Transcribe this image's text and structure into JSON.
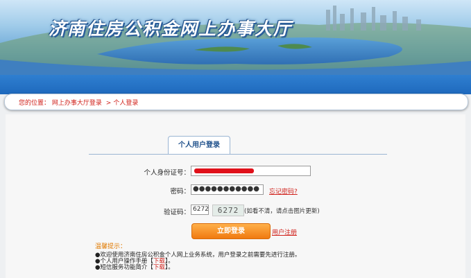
{
  "banner": {
    "title": "济南住房公积金网上办事大厅"
  },
  "breadcrumb": {
    "prefix": "您的位置：",
    "home": "网上办事大厅登录",
    "separator": ">",
    "current": "个人登录"
  },
  "login": {
    "tab_label": "个人用户登录",
    "id_label": "个人身份证号：",
    "password_label": "密码：",
    "password_value": "●●●●●●●●●●●",
    "forgot_label": "忘记密码?",
    "captcha_label": "验证码：",
    "captcha_value": "6272",
    "captcha_image_text": "6272",
    "captcha_hint": "(如看不清，请点击图片更新)",
    "login_button": "立即登录",
    "register_link": "用户注册"
  },
  "tips": {
    "title": "温馨提示：",
    "items": [
      {
        "text": "●欢迎使用济南住房公积金个人网上业务系统，用户登录之前需要先进行注册。"
      },
      {
        "text": "●个人用户操作手册【",
        "download": "下载",
        "close": "】。"
      },
      {
        "text": "●短信服务功能简介【",
        "download": "下载",
        "close": "】。"
      }
    ]
  },
  "colors": {
    "accent_red": "#d0201a",
    "nav_blue": "#1e69bd",
    "button_orange": "#f07a10"
  }
}
